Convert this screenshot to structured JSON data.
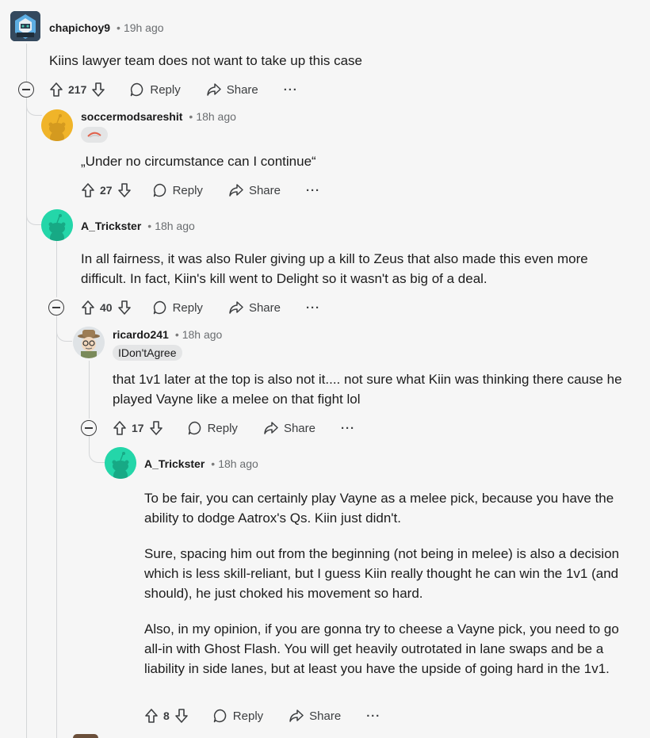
{
  "comments": [
    {
      "author": "chapichoy9",
      "time": "19h ago",
      "body": [
        "Kiins lawyer team does not want to take up this case"
      ],
      "votes": "217"
    },
    {
      "author": "soccermodsareshit",
      "time": "18h ago",
      "body": [
        "„Under no circumstance can I continue“"
      ],
      "votes": "27"
    },
    {
      "author": "A_Trickster",
      "time": "18h ago",
      "body": [
        "In all fairness, it was also Ruler giving up a kill to Zeus that also made this even more difficult. In fact, Kiin's kill went to Delight so it wasn't as big of a deal."
      ],
      "votes": "40"
    },
    {
      "author": "ricardo241",
      "time": "18h ago",
      "flair": "IDon'tAgree",
      "body": [
        "that 1v1 later at the top is also not it.... not sure what Kiin was thinking there cause he played Vayne like a melee on that fight lol"
      ],
      "votes": "17"
    },
    {
      "author": "A_Trickster",
      "time": "18h ago",
      "body": [
        "To be fair, you can certainly play Vayne as a melee pick, because you have the ability to dodge Aatrox's Qs. Kiin just didn't.",
        "Sure, spacing him out from the beginning (not being in melee) is also a decision which is less skill-reliant, but I guess Kiin really thought he can win the 1v1 (and should), he just choked his movement so hard.",
        "Also, in my opinion, if you are gonna try to cheese a Vayne pick, you need to go all-in with Ghost Flash. You will get heavily outrotated in lane swaps and be a liability in side lanes, but at least you have the upside of going hard in the 1v1."
      ],
      "votes": "8"
    }
  ],
  "labels": {
    "reply": "Reply",
    "share": "Share",
    "more": "···",
    "separator": "•"
  },
  "colors": {
    "background": "#f6f6f6",
    "thread_line": "#d4d6d8",
    "snoo_yellow": "#f0b429",
    "snoo_teal": "#24d6a9"
  }
}
